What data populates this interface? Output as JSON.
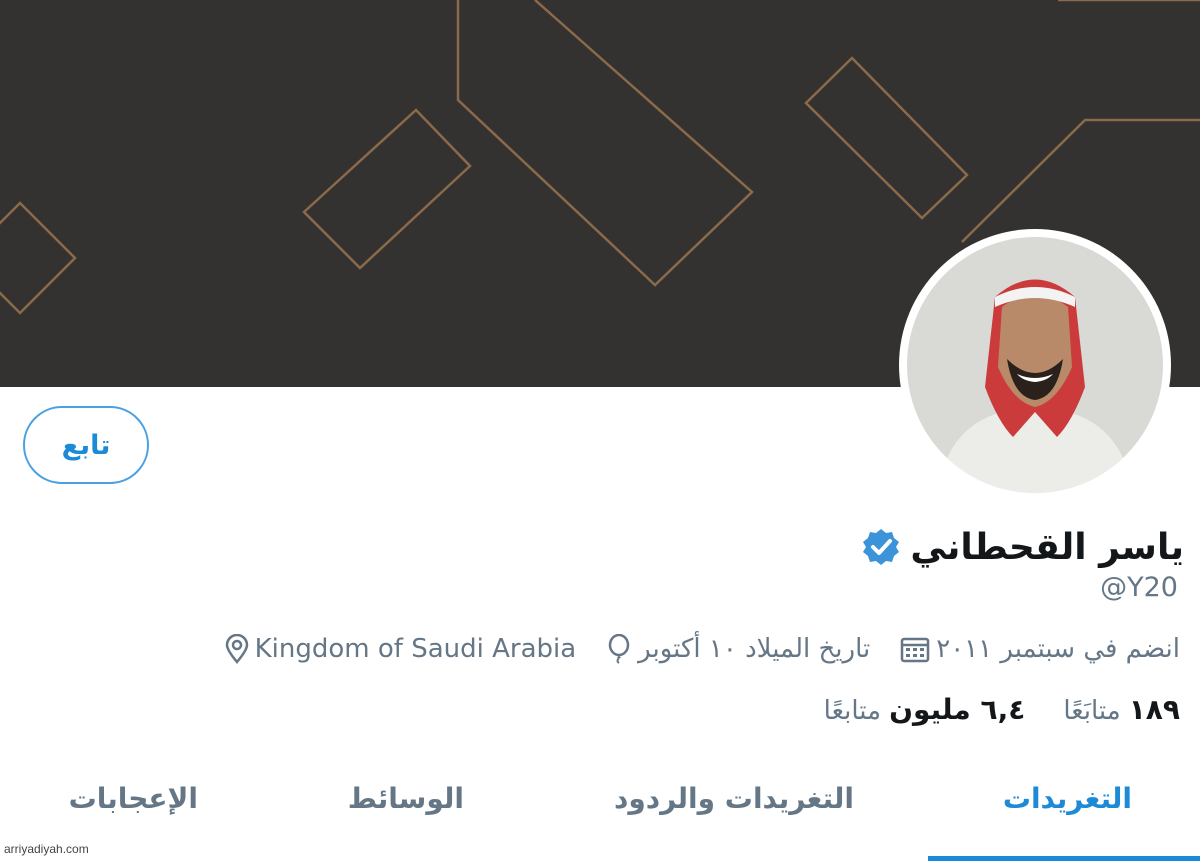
{
  "profile": {
    "display_name": "ياسر القحطاني",
    "handle": "@Y20",
    "follow_label": "تابع",
    "location": "Kingdom of Saudi Arabia",
    "birthday": "تاريخ الميلاد ١٠ أكتوبر",
    "joined": "انضم في سبتمبر ٢٠١١"
  },
  "stats": {
    "following_count": "١٨٩",
    "following_label": "متابَعًا",
    "followers_count": "٦,٤ مليون",
    "followers_label": "متابعًا"
  },
  "tabs": [
    {
      "label": "التغريدات",
      "active": true
    },
    {
      "label": "التغريدات والردود",
      "active": false
    },
    {
      "label": "الوسائط",
      "active": false
    },
    {
      "label": "الإعجابات",
      "active": false
    }
  ],
  "watermark": "arriyadiyah.com",
  "icons": {
    "verified": "verified-badge-icon",
    "location": "location-pin-icon",
    "birthday": "balloon-icon",
    "joined": "calendar-icon"
  },
  "colors": {
    "accent": "#1d8ad8",
    "banner": "#333230",
    "banner_lines": "#8a6a4a",
    "muted_text": "#657786"
  }
}
